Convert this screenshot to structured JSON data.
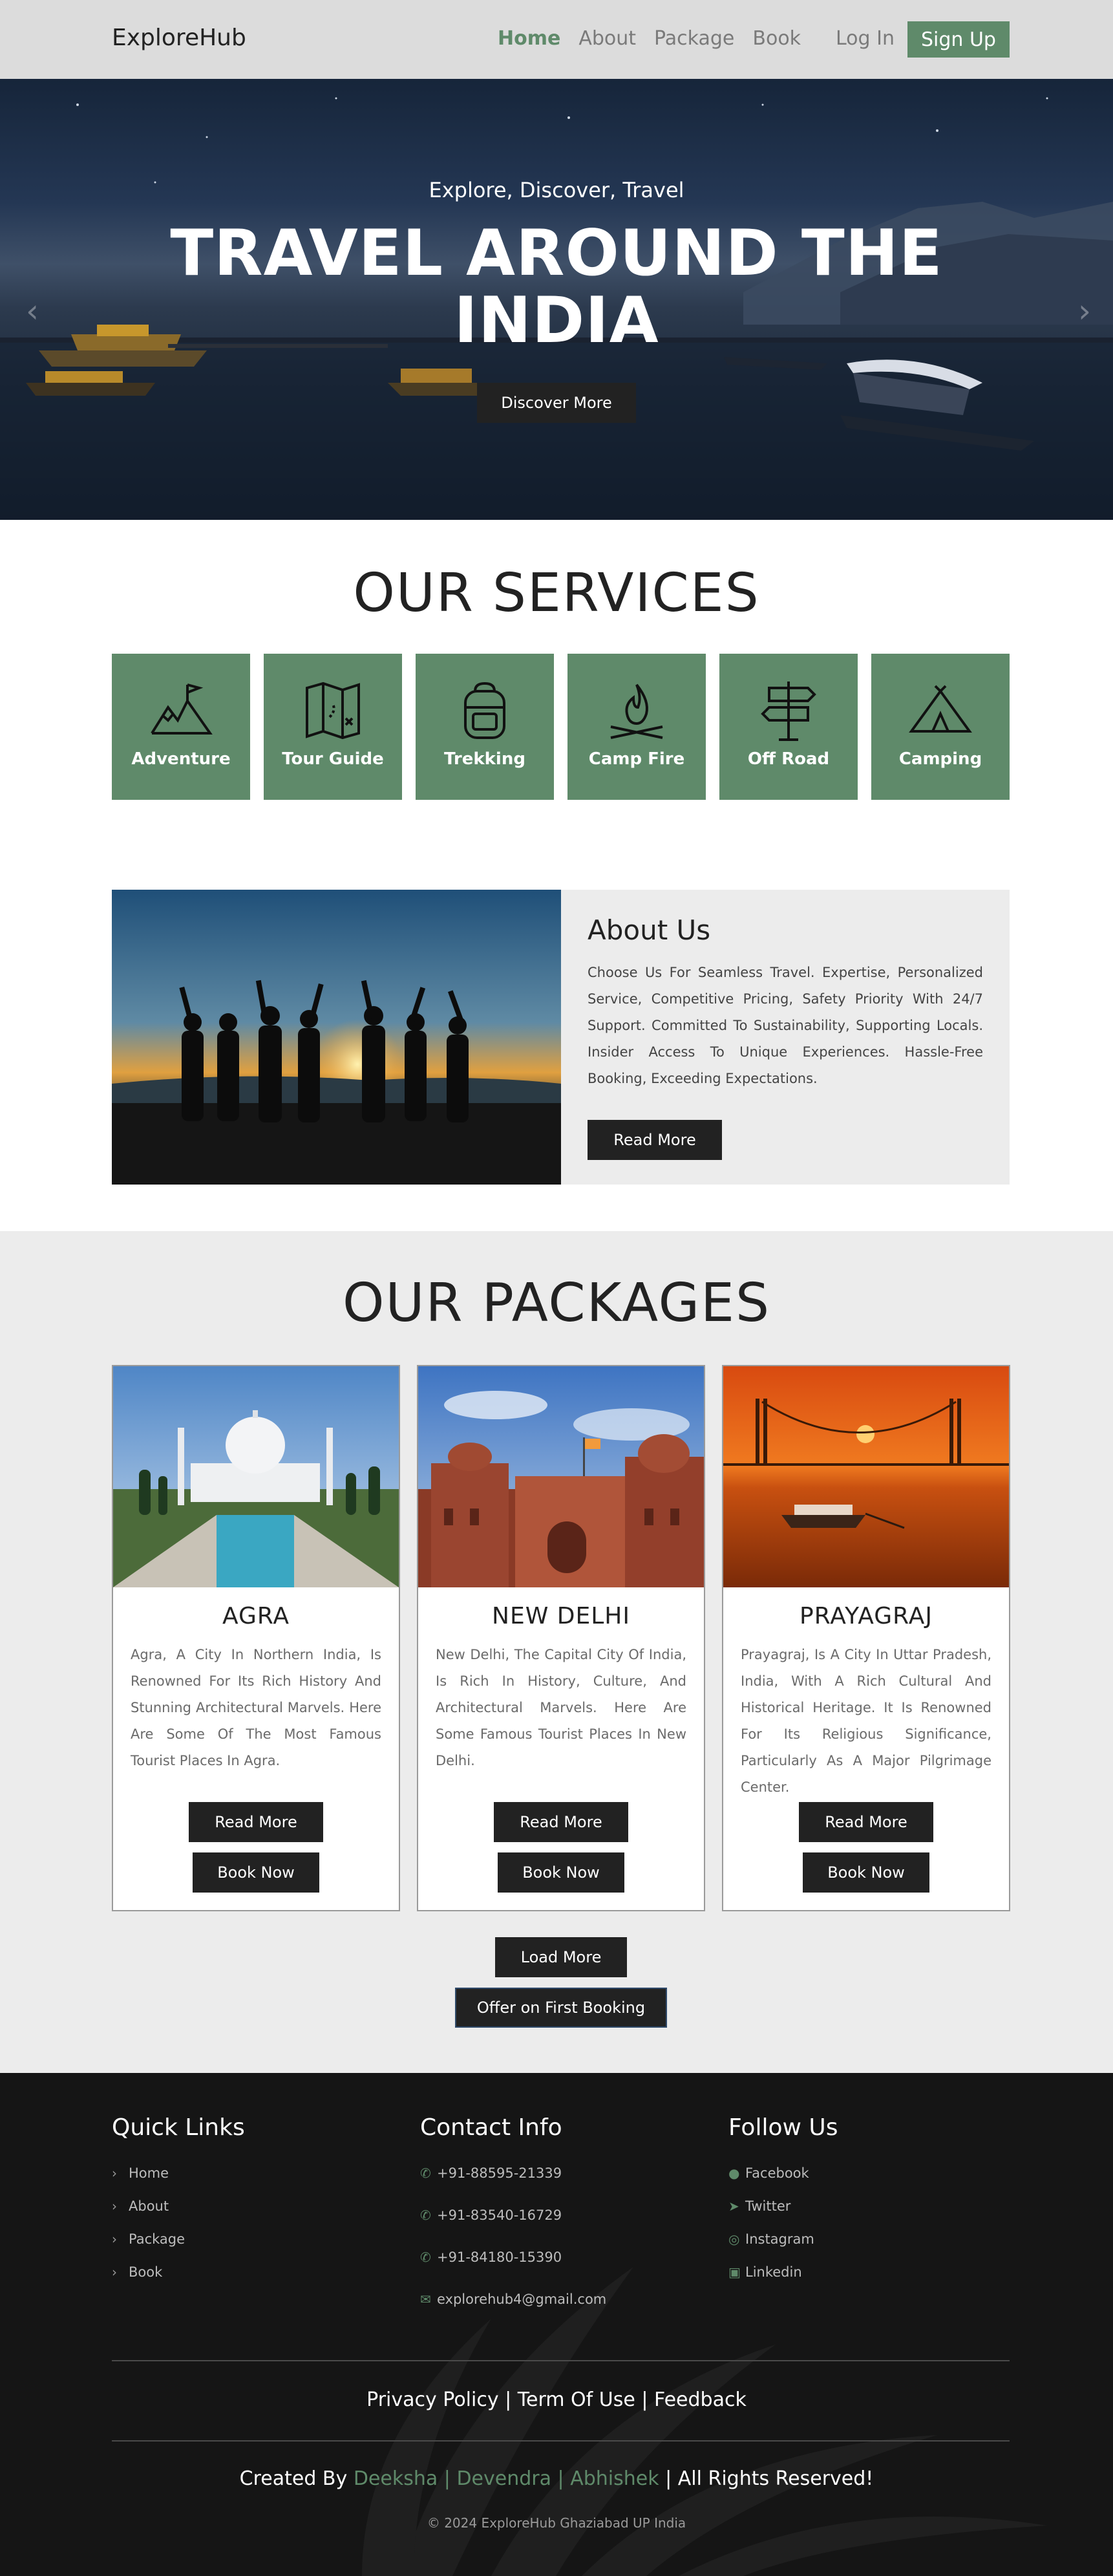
{
  "colors": {
    "accent": "#5f8a6a",
    "dark": "#222222",
    "nav_bg": "#dcdcdc",
    "section_bg": "#ececec",
    "footer_bg": "#151515"
  },
  "nav": {
    "brand": "ExploreHub",
    "links": [
      "Home",
      "About",
      "Package",
      "Book"
    ],
    "login": "Log In",
    "signup": "Sign Up"
  },
  "hero": {
    "subtitle": "Explore, Discover, Travel",
    "title_line1": "TRAVEL AROUND THE",
    "title_line2": "INDIA",
    "button": "Discover More"
  },
  "services": {
    "title": "OUR SERVICES",
    "items": [
      {
        "label": "Adventure",
        "icon": "mountain-flag-icon"
      },
      {
        "label": "Tour Guide",
        "icon": "map-icon"
      },
      {
        "label": "Trekking",
        "icon": "backpack-icon"
      },
      {
        "label": "Camp Fire",
        "icon": "campfire-icon"
      },
      {
        "label": "Off Road",
        "icon": "signpost-icon"
      },
      {
        "label": "Camping",
        "icon": "tent-icon"
      }
    ]
  },
  "about": {
    "title": "About Us",
    "text": "Choose Us For Seamless Travel. Expertise, Personalized Service, Competitive Pricing, Safety Priority With 24/7 Support. Committed To Sustainability, Supporting Locals. Insider Access To Unique Experiences. Hassle-Free Booking, Exceeding Expectations.",
    "button": "Read More"
  },
  "packages": {
    "title": "OUR PACKAGES",
    "items": [
      {
        "title": "AGRA",
        "text": "Agra, A City In Northern India, Is Renowned For Its Rich History And Stunning Architectural Marvels. Here Are Some Of The Most Famous Tourist Places In Agra.",
        "read_more": "Read More",
        "book_now": "Book Now"
      },
      {
        "title": "NEW DELHI",
        "text": "New Delhi, The Capital City Of India, Is Rich In History, Culture, And Architectural Marvels. Here Are Some Famous Tourist Places In New Delhi.",
        "read_more": "Read More",
        "book_now": "Book Now"
      },
      {
        "title": "PRAYAGRAJ",
        "text": "Prayagraj, Is A City In Uttar Pradesh, India, With A Rich Cultural And Historical Heritage. It Is Renowned For Its Religious Significance, Particularly As A Major Pilgrimage Center.",
        "read_more": "Read More",
        "book_now": "Book Now"
      }
    ],
    "load_more": "Load More",
    "offer": "Offer on First Booking"
  },
  "footer": {
    "quick_links": {
      "title": "Quick Links",
      "items": [
        "Home",
        "About",
        "Package",
        "Book"
      ]
    },
    "contact": {
      "title": "Contact Info",
      "phones": [
        "+91-88595-21339",
        "+91-83540-16729",
        "+91-84180-15390"
      ],
      "email": "explorehub4@gmail.com"
    },
    "follow": {
      "title": "Follow Us",
      "items": [
        "Facebook",
        "Twitter",
        "Instagram",
        "Linkedin"
      ]
    },
    "links_line": "Privacy Policy | Term Of Use | Feedback",
    "created_by": "Created By",
    "names": [
      "Deeksha",
      "Devendra",
      "Abhishek"
    ],
    "sep": "|",
    "rights": "| All Rights Reserved!",
    "copyright": "© 2024 ExploreHub Ghaziabad UP India"
  }
}
